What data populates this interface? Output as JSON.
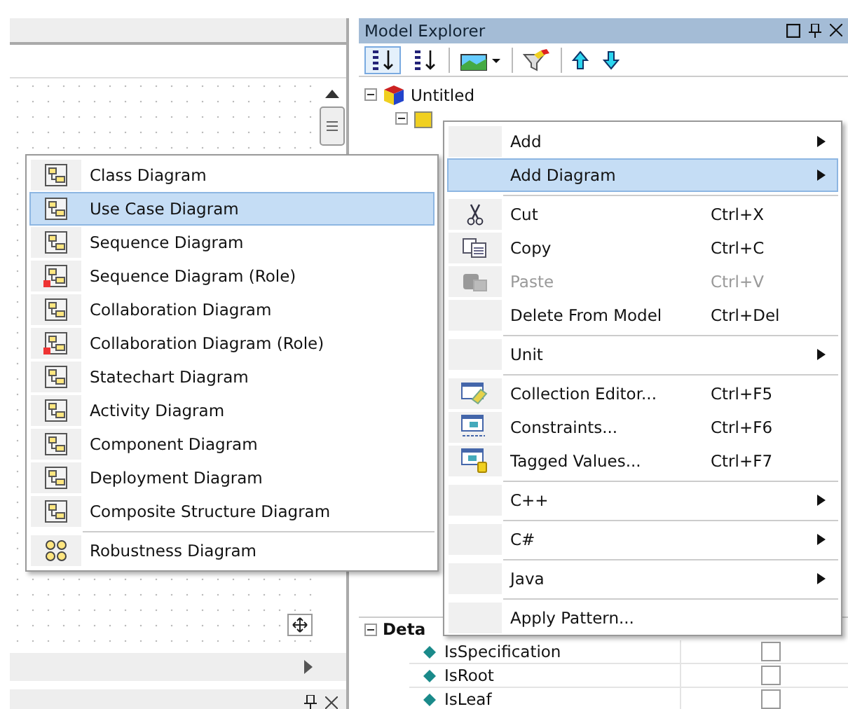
{
  "model_explorer": {
    "title": "Model Explorer",
    "tree": [
      {
        "label": "Untitled",
        "expanded": true,
        "children": [
          {
            "expanded": true
          }
        ]
      }
    ],
    "details": {
      "title": "Deta",
      "expanded": true,
      "properties": [
        {
          "name": "IsSpecification",
          "checked": false
        },
        {
          "name": "IsRoot",
          "checked": false
        },
        {
          "name": "IsLeaf",
          "checked": false
        }
      ]
    }
  },
  "context_menu": {
    "groups": [
      {
        "items": [
          {
            "label": "Add",
            "submenu": true,
            "selected": false,
            "disabled": false
          },
          {
            "label": "Add Diagram",
            "submenu": true,
            "selected": true,
            "disabled": false
          }
        ]
      },
      {
        "items": [
          {
            "label": "Cut",
            "shortcut": "Ctrl+X",
            "submenu": false,
            "selected": false,
            "disabled": false
          },
          {
            "label": "Copy",
            "shortcut": "Ctrl+C",
            "submenu": false,
            "selected": false,
            "disabled": false
          },
          {
            "label": "Paste",
            "shortcut": "Ctrl+V",
            "submenu": false,
            "selected": false,
            "disabled": true
          },
          {
            "label": "Delete From Model",
            "shortcut": "Ctrl+Del",
            "submenu": false,
            "selected": false,
            "disabled": false
          }
        ]
      },
      {
        "items": [
          {
            "label": "Unit",
            "submenu": true,
            "selected": false,
            "disabled": false
          }
        ]
      },
      {
        "items": [
          {
            "label": "Collection Editor...",
            "shortcut": "Ctrl+F5",
            "submenu": false,
            "selected": false,
            "disabled": false
          },
          {
            "label": "Constraints...",
            "shortcut": "Ctrl+F6",
            "submenu": false,
            "selected": false,
            "disabled": false
          },
          {
            "label": "Tagged Values...",
            "shortcut": "Ctrl+F7",
            "submenu": false,
            "selected": false,
            "disabled": false
          }
        ]
      },
      {
        "items": [
          {
            "label": "C++",
            "submenu": true,
            "selected": false,
            "disabled": false
          }
        ]
      },
      {
        "items": [
          {
            "label": "C#",
            "submenu": true,
            "selected": false,
            "disabled": false
          }
        ]
      },
      {
        "items": [
          {
            "label": "Java",
            "submenu": true,
            "selected": false,
            "disabled": false
          }
        ]
      },
      {
        "items": [
          {
            "label": "Apply Pattern...",
            "submenu": false,
            "selected": false,
            "disabled": false
          }
        ]
      }
    ]
  },
  "diagram_submenu": {
    "groups": [
      {
        "items": [
          {
            "label": "Class Diagram",
            "selected": false
          },
          {
            "label": "Use Case Diagram",
            "selected": true
          },
          {
            "label": "Sequence Diagram",
            "selected": false
          },
          {
            "label": "Sequence Diagram (Role)",
            "selected": false
          },
          {
            "label": "Collaboration Diagram",
            "selected": false
          },
          {
            "label": "Collaboration Diagram (Role)",
            "selected": false
          },
          {
            "label": "Statechart Diagram",
            "selected": false
          },
          {
            "label": "Activity Diagram",
            "selected": false
          },
          {
            "label": "Component Diagram",
            "selected": false
          },
          {
            "label": "Deployment Diagram",
            "selected": false
          },
          {
            "label": "Composite Structure Diagram",
            "selected": false
          }
        ]
      },
      {
        "items": [
          {
            "label": "Robustness Diagram",
            "selected": false
          }
        ]
      }
    ]
  }
}
